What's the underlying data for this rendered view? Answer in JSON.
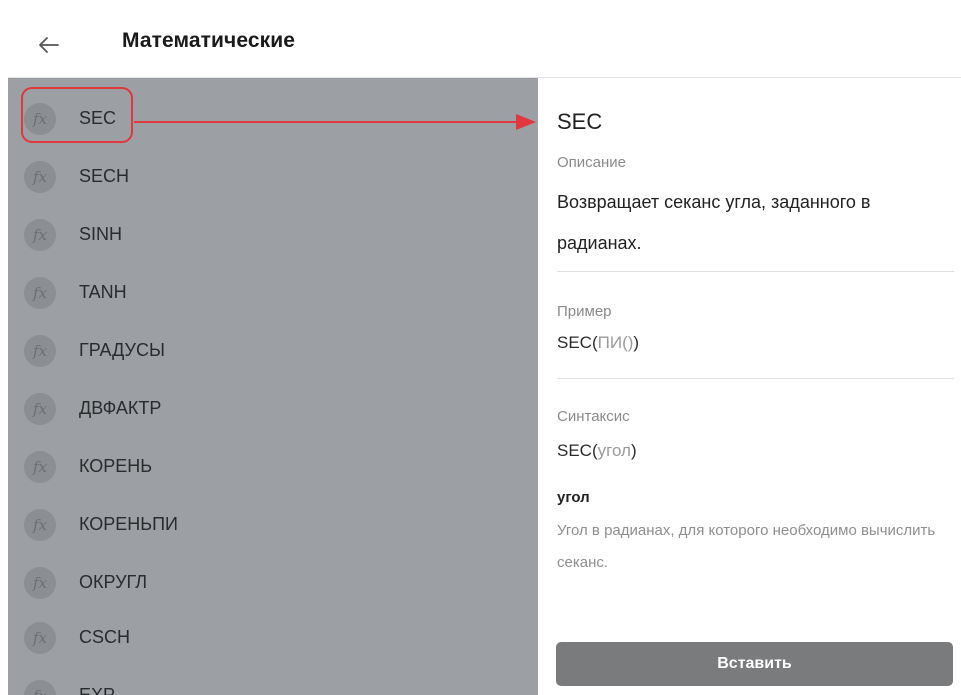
{
  "header": {
    "back_icon": "arrow-left-icon",
    "title": "Математические"
  },
  "functions": [
    {
      "icon": "fx",
      "label": "SEC"
    },
    {
      "icon": "fx",
      "label": "SECH"
    },
    {
      "icon": "fx",
      "label": "SINH"
    },
    {
      "icon": "fx",
      "label": "TANH"
    },
    {
      "icon": "fx",
      "label": "ГРАДУСЫ"
    },
    {
      "icon": "fx",
      "label": "ДВФАКТР"
    },
    {
      "icon": "fx",
      "label": "КОРЕНЬ"
    },
    {
      "icon": "fx",
      "label": "КОРЕНЬПИ"
    },
    {
      "icon": "fx",
      "label": "ОКРУГЛ"
    },
    {
      "icon": "fx",
      "label": "CSCH"
    },
    {
      "icon": "fx",
      "label": "EXP"
    }
  ],
  "detail": {
    "title": "SEC",
    "description_label": "Описание",
    "description": "Возвращает секанс угла, заданного в радианах.",
    "example_label": "Пример",
    "example_fn": "SEC(",
    "example_arg": "ПИ()",
    "example_close": ")",
    "syntax_label": "Синтаксис",
    "syntax_fn": "SEC(",
    "syntax_arg": "угол",
    "syntax_close": ")",
    "param_name": "угол",
    "param_desc": "Угол в радианах, для которого необходимо вычислить секанс.",
    "insert_label": "Вставить"
  },
  "colors": {
    "overlay": "#9c9fa3",
    "highlight": "#e0383e",
    "button": "#7a7b7d"
  }
}
